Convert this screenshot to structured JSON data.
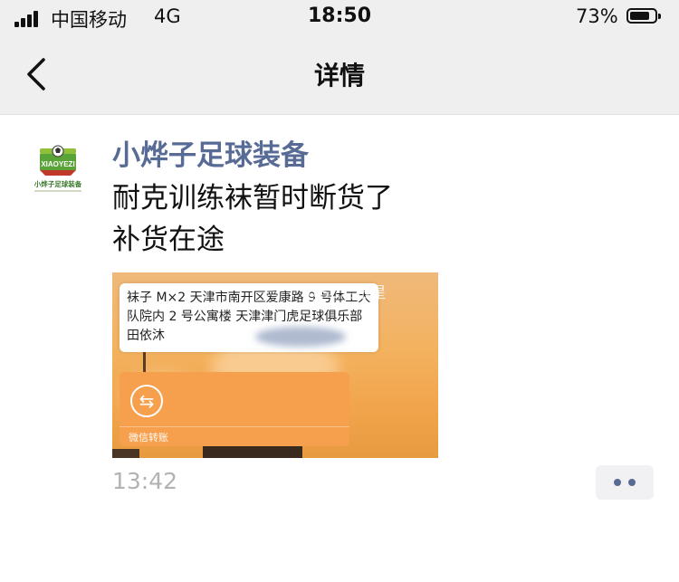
{
  "status_bar": {
    "carrier": "中国移动",
    "network": "4G",
    "time": "18:50",
    "battery_percent": "73%",
    "battery_level": 0.73
  },
  "nav": {
    "title": "详情",
    "back_icon": "chevron-left-icon"
  },
  "post": {
    "author": "小烨子足球装备",
    "avatar_text": "XIAOYEZI",
    "avatar_caption": "小烨子足球装备",
    "text": "耐克训练袜暂时断货了\n补货在途",
    "image": {
      "message_bubble": "袜子 M×2 天津市南开区爱康路 9 号体工大队院内 2 号公寓楼 天津津门虎足球俱乐部 田依沐",
      "watermark": "@SC若银星",
      "transfer_label": "微信转账"
    },
    "time": "13:42",
    "more_icon": "more-dots-icon"
  },
  "colors": {
    "link_blue": "#576b95",
    "nav_bg": "#efefef",
    "transfer_orange": "#f6a04d"
  }
}
